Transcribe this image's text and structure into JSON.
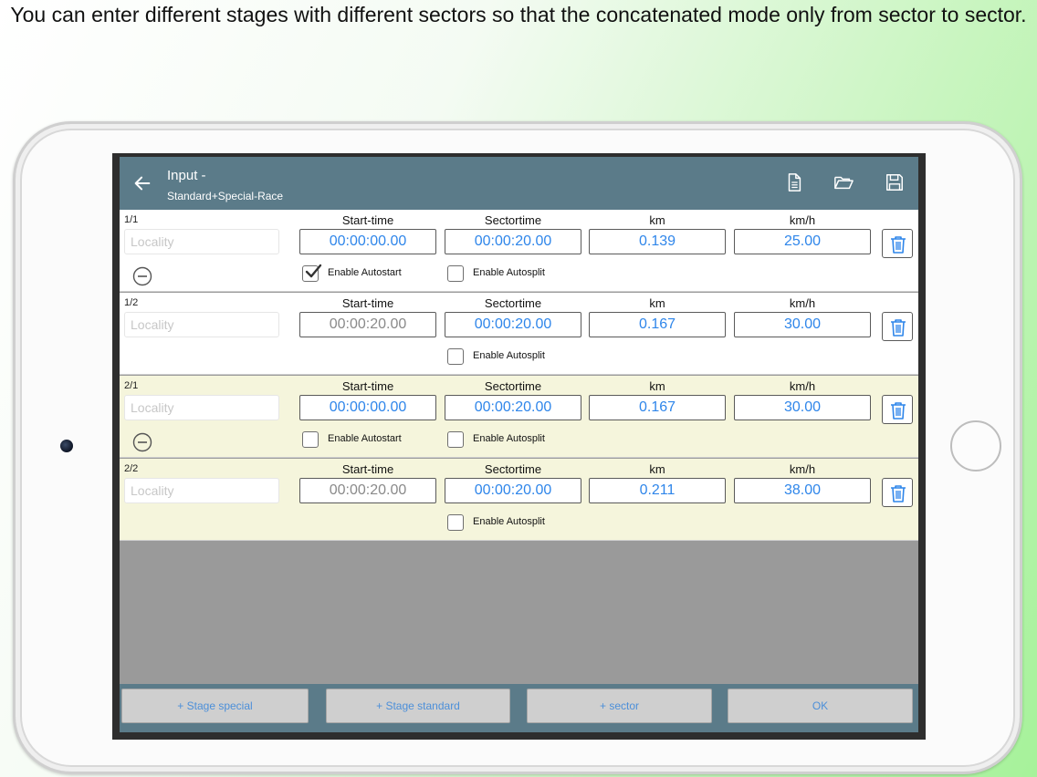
{
  "caption": "You can enter different stages with different sectors so that the concatenated mode only from sector to sector.",
  "header": {
    "title": "Input -",
    "subtitle": "Standard+Special-Race",
    "icons": [
      "back-arrow-icon",
      "document-icon",
      "folder-open-icon",
      "save-icon"
    ]
  },
  "columns": {
    "start": "Start-time",
    "sector": "Sectortime",
    "km": "km",
    "kmh": "km/h"
  },
  "locality_placeholder": "Locality",
  "labels": {
    "autostart": "Enable Autostart",
    "autosplit": "Enable Autosplit"
  },
  "rows": [
    {
      "id": "1/1",
      "start": "00:00:00.00",
      "sector": "00:00:20.00",
      "km": "0.139",
      "kmh": "25.00",
      "autostart": true,
      "autosplit": false
    },
    {
      "id": "1/2",
      "start": "00:00:20.00",
      "sector": "00:00:20.00",
      "km": "0.167",
      "kmh": "30.00",
      "autosplit": false
    },
    {
      "id": "2/1",
      "start": "00:00:00.00",
      "sector": "00:00:20.00",
      "km": "0.167",
      "kmh": "30.00",
      "autostart": false,
      "autosplit": false
    },
    {
      "id": "2/2",
      "start": "00:00:20.00",
      "sector": "00:00:20.00",
      "km": "0.211",
      "kmh": "38.00",
      "autosplit": false
    }
  ],
  "buttons": {
    "stage_special": "+ Stage special",
    "stage_standard": "+ Stage standard",
    "sector": "+ sector",
    "ok": "OK"
  },
  "colors": {
    "header": "#5b7b89",
    "value_blue": "#2f86ea",
    "stage2_background": "#f5f5dc"
  }
}
